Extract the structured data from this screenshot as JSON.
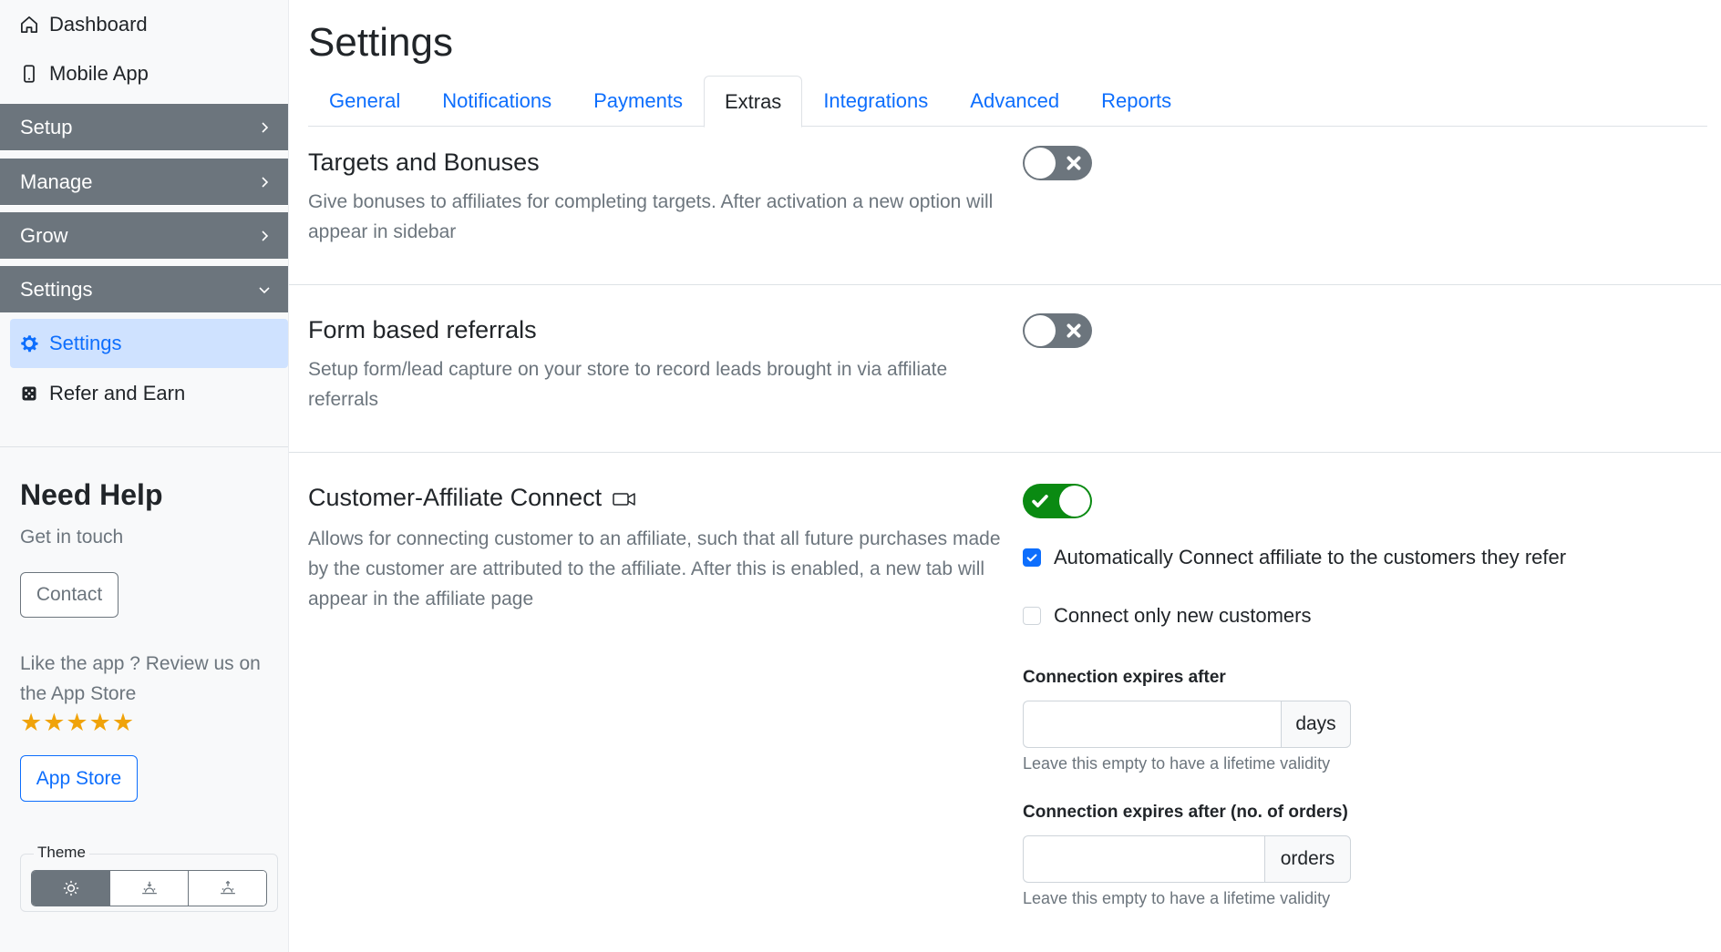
{
  "sidebar": {
    "top_links": [
      {
        "label": "Dashboard",
        "icon": "home-icon"
      },
      {
        "label": "Mobile App",
        "icon": "mobile-icon"
      }
    ],
    "groups": [
      {
        "label": "Setup",
        "expanded": false
      },
      {
        "label": "Manage",
        "expanded": false
      },
      {
        "label": "Grow",
        "expanded": false
      },
      {
        "label": "Settings",
        "expanded": true
      }
    ],
    "sub_items": [
      {
        "label": "Settings",
        "icon": "gear-icon",
        "active": true
      },
      {
        "label": "Refer and Earn",
        "icon": "dice-icon",
        "active": false
      }
    ],
    "help": {
      "title": "Need Help",
      "subtitle": "Get in touch",
      "contact_label": "Contact",
      "review_text": "Like the app ? Review us on the App Store",
      "stars": "★★★★★",
      "rating": 5,
      "app_store_label": "App Store"
    },
    "theme": {
      "legend": "Theme",
      "options": [
        "light",
        "sunset",
        "sunrise"
      ],
      "selected": "light"
    }
  },
  "main": {
    "title": "Settings",
    "tabs": [
      {
        "label": "General",
        "active": false
      },
      {
        "label": "Notifications",
        "active": false
      },
      {
        "label": "Payments",
        "active": false
      },
      {
        "label": "Extras",
        "active": true
      },
      {
        "label": "Integrations",
        "active": false
      },
      {
        "label": "Advanced",
        "active": false
      },
      {
        "label": "Reports",
        "active": false
      }
    ],
    "sections": {
      "targets": {
        "title": "Targets and Bonuses",
        "description": "Give bonuses to affiliates for completing targets. After activation a new option will appear in sidebar",
        "enabled": false
      },
      "form_referrals": {
        "title": "Form based referrals",
        "description": "Setup form/lead capture on your store to record leads brought in via affiliate referrals",
        "enabled": false
      },
      "connect": {
        "title": "Customer-Affiliate Connect",
        "description": "Allows for connecting customer to an affiliate, such that all future purchases made by the customer are attributed to the affiliate. After this is enabled, a new tab will appear in the affiliate page",
        "enabled": true,
        "auto_connect_label": "Automatically Connect affiliate to the customers they refer",
        "auto_connect_checked": true,
        "only_new_label": "Connect only new customers",
        "only_new_checked": false,
        "expires_label": "Connection expires after",
        "expires_value": "",
        "expires_unit": "days",
        "expires_help": "Leave this empty to have a lifetime validity",
        "expires_orders_label": "Connection expires after (no. of orders)",
        "expires_orders_value": "",
        "expires_orders_unit": "orders",
        "expires_orders_help": "Leave this empty to have a lifetime validity"
      }
    }
  },
  "colors": {
    "primary": "#0d6efd",
    "secondary": "#6c757d",
    "toggle_on": "#0a8a12",
    "stars": "#f0a30a"
  }
}
